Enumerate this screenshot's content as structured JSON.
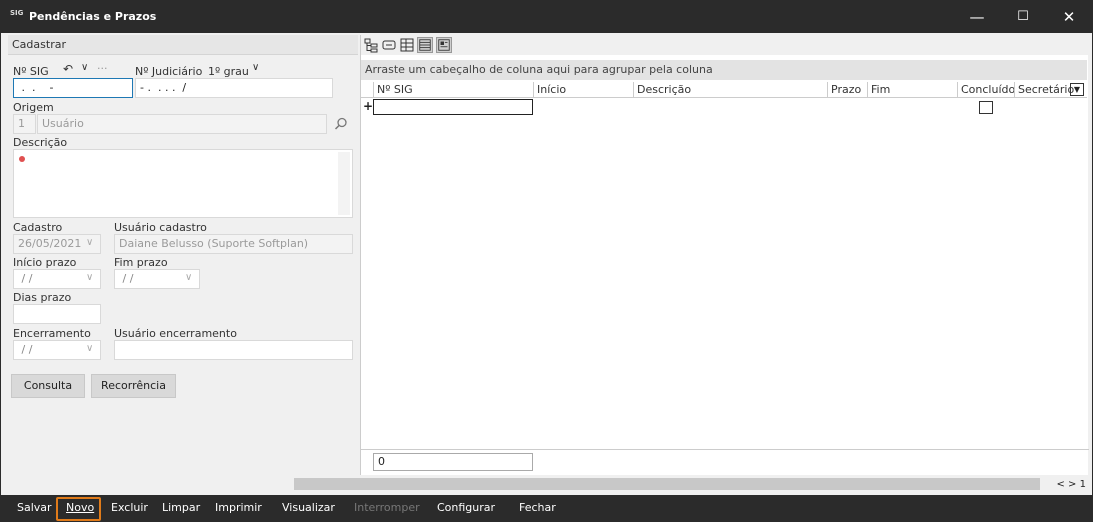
{
  "window": {
    "app_icon": "SIG",
    "title": "Pendências e Prazos",
    "controls": {
      "minimize": "—",
      "maximize": "☐",
      "close": "✕"
    }
  },
  "left_panel": {
    "header": "Cadastrar",
    "nsig_label": "Nº SIG",
    "nsig_value": " .  .    -",
    "undo_glyph": "↶",
    "chevron_glyph": "∨",
    "more_glyph": "···",
    "njudicial_label": "Nº Judiciário",
    "grau_label": "1º grau",
    "njudicial_value": "- .  . . .  /",
    "origem_label": "Origem",
    "origem_code": "1",
    "origem_value": "Usuário",
    "descricao_label": "Descrição",
    "cadastro_label": "Cadastro",
    "cadastro_value": "26/05/2021",
    "usuario_cadastro_label": "Usuário cadastro",
    "usuario_cadastro_value": "Daiane Belusso (Suporte Softplan)",
    "inicio_prazo_label": "Início prazo",
    "inicio_prazo_value": " / /",
    "fim_prazo_label": "Fim prazo",
    "fim_prazo_value": " / /",
    "dias_prazo_label": "Dias prazo",
    "encerramento_label": "Encerramento",
    "encerramento_value": " / /",
    "usuario_encerramento_label": "Usuário encerramento",
    "consulta_button": "Consulta",
    "recorrencia_button": "Recorrência"
  },
  "grid": {
    "group_hint": "Arraste um cabeçalho de coluna aqui para agrupar pela coluna",
    "columns": [
      "Nº SIG",
      "Início",
      "Descrição",
      "Prazo",
      "Fim",
      "Concluído",
      "Secretário"
    ],
    "new_row_marker": "+",
    "footer_count": "0"
  },
  "pager": {
    "prev": "<",
    "next": ">",
    "page": "1"
  },
  "bottom_bar": {
    "salvar": "Salvar",
    "novo": "Novo",
    "excluir": "Excluir",
    "limpar": "Limpar",
    "imprimir": "Imprimir",
    "visualizar": "Visualizar",
    "interromper": "Interromper",
    "configurar": "Configurar",
    "fechar": "Fechar"
  },
  "colors": {
    "titlebar": "#2b2b2b",
    "focus": "#1e78b4",
    "highlight": "#e07b1a",
    "required_dot": "#e05050"
  }
}
